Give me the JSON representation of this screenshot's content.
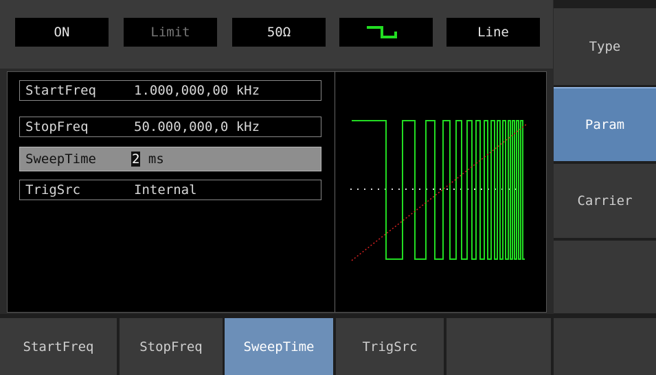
{
  "status_bar": {
    "output": "ON",
    "limit": "Limit",
    "load": "50Ω",
    "waveform_icon": "square-wave-icon",
    "sweep_mode": "Line"
  },
  "params": [
    {
      "label": "StartFreq",
      "value": "1.000,000,00 kHz"
    },
    {
      "label": "StopFreq",
      "value": "50.000,000,0 kHz"
    },
    {
      "label": "SweepTime",
      "value_cursor": "2",
      "value_rest": " ms"
    },
    {
      "label": "TrigSrc",
      "value": "Internal"
    }
  ],
  "softkeys": {
    "type": "Type",
    "param": "Param",
    "carrier": "Carrier"
  },
  "tabs": [
    "StartFreq",
    "StopFreq",
    "SweepTime",
    "TrigSrc"
  ],
  "colors": {
    "waveform": "#22dd22",
    "sweep_ramp": "#dd2222",
    "selected_key": "#5b84b4"
  }
}
